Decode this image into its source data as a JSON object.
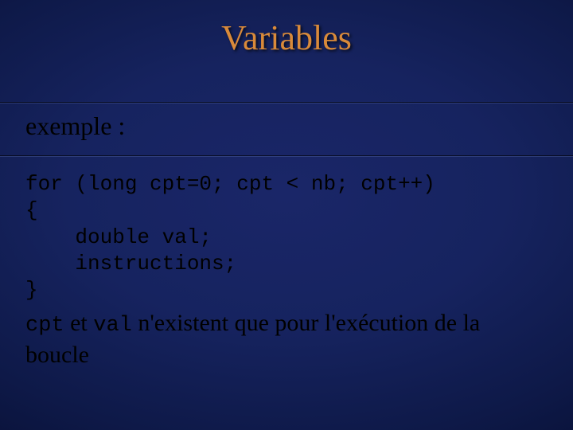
{
  "title": "Variables",
  "subtitle": "exemple :",
  "code": {
    "l1": "for (long cpt=0; cpt < nb; cpt++)",
    "l2": "{",
    "l3": "    double val;",
    "l4": "    instructions;",
    "l5": "}"
  },
  "note": {
    "cpt": "cpt",
    "et": " et ",
    "val": "val",
    "rest": " n'existent que pour l'exécution de la boucle"
  }
}
